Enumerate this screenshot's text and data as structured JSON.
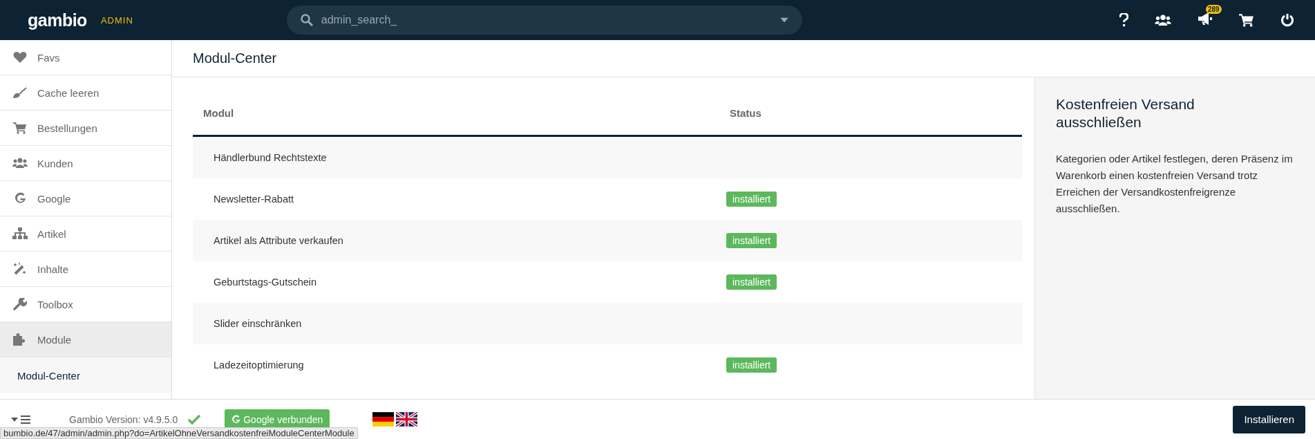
{
  "header": {
    "logo": "gambio",
    "badge_text": "ADMIN",
    "search": {
      "placeholder": "admin_search_"
    },
    "notification_count": "289"
  },
  "sidebar": {
    "items": [
      {
        "kind": "heart",
        "label": "Favs",
        "selected": false
      },
      {
        "kind": "brush",
        "label": "Cache leeren",
        "selected": false
      },
      {
        "kind": "cart",
        "label": "Bestellungen",
        "selected": false
      },
      {
        "kind": "users",
        "label": "Kunden",
        "selected": false
      },
      {
        "kind": "google",
        "label": "Google",
        "selected": false
      },
      {
        "kind": "sitemap",
        "label": "Artikel",
        "selected": false
      },
      {
        "kind": "wand",
        "label": "Inhalte",
        "selected": false
      },
      {
        "kind": "wrench",
        "label": "Toolbox",
        "selected": false
      },
      {
        "kind": "puzzle",
        "label": "Module",
        "selected": true,
        "children": [
          {
            "label": "Modul-Center",
            "selected": true
          }
        ]
      }
    ]
  },
  "page_title": "Modul-Center",
  "table": {
    "columns": [
      "Modul",
      "Status"
    ],
    "rows": [
      {
        "name": "Händlerbund Rechtstexte"
      },
      {
        "name": "Newsletter-Rabatt",
        "status": "installiert"
      },
      {
        "name": "Artikel als Attribute verkaufen",
        "status": "installiert"
      },
      {
        "name": "Geburtstags-Gutschein",
        "status": "installiert"
      },
      {
        "name": "Slider einschränken"
      },
      {
        "name": "Ladezeitoptimierung",
        "status": "installiert"
      }
    ]
  },
  "details": {
    "title": "Kostenfreien Versand ausschließen",
    "description": "Kategorien oder Artikel festlegen, deren Präsenz im Warenkorb einen kostenfreien Versand trotz Erreichen der Versandkostenfreigrenze ausschließen."
  },
  "footer": {
    "version": "Gambio Version: v4.9.5.0",
    "google_button": "Google verbunden",
    "install_button": "Installieren"
  },
  "status_url": "bumbio.de/47/admin/admin.php?do=ArtikelOhneVersandkostenfreiModuleCenterModule"
}
